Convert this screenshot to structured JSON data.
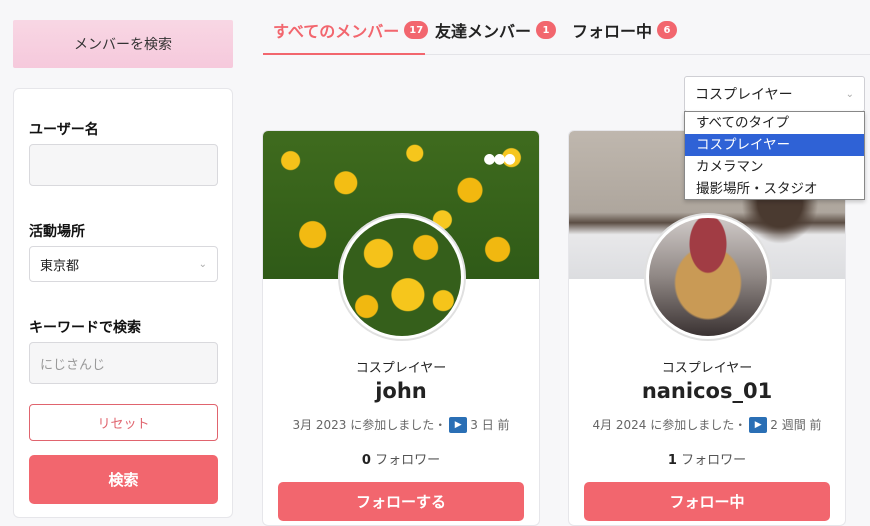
{
  "sidebar": {
    "header": "メンバーを検索",
    "username_label": "ユーザー名",
    "username_value": "",
    "location_label": "活動場所",
    "location_value": "東京都",
    "keyword_label": "キーワードで検索",
    "keyword_placeholder": "にじさんじ",
    "reset_label": "リセット",
    "search_label": "検索"
  },
  "tabs": [
    {
      "label": "すべてのメンバー",
      "count": "17",
      "active": true
    },
    {
      "label": "友達メンバー",
      "count": "1",
      "active": false
    },
    {
      "label": "フォロー中",
      "count": "6",
      "active": false
    }
  ],
  "type_filter": {
    "selected": "コスプレイヤー",
    "options": [
      "すべてのタイプ",
      "コスプレイヤー",
      "カメラマン",
      "撮影場所・スタジオ"
    ]
  },
  "members": [
    {
      "type": "コスプレイヤー",
      "name": "john",
      "joined": "3月 2023 に参加しました・",
      "last_active": "3 日 前",
      "followers_count": "0",
      "followers_label": "フォロワー",
      "button": "フォローする"
    },
    {
      "type": "コスプレイヤー",
      "name": "nanicos_01",
      "joined": "4月 2024 に参加しました・",
      "last_active": "2 週間 前",
      "followers_count": "1",
      "followers_label": "フォロワー",
      "button": "フォロー中"
    }
  ],
  "colors": {
    "accent": "#f2666e",
    "header_pink": "#f8d7e4",
    "dropdown_selected": "#2f62d6"
  }
}
